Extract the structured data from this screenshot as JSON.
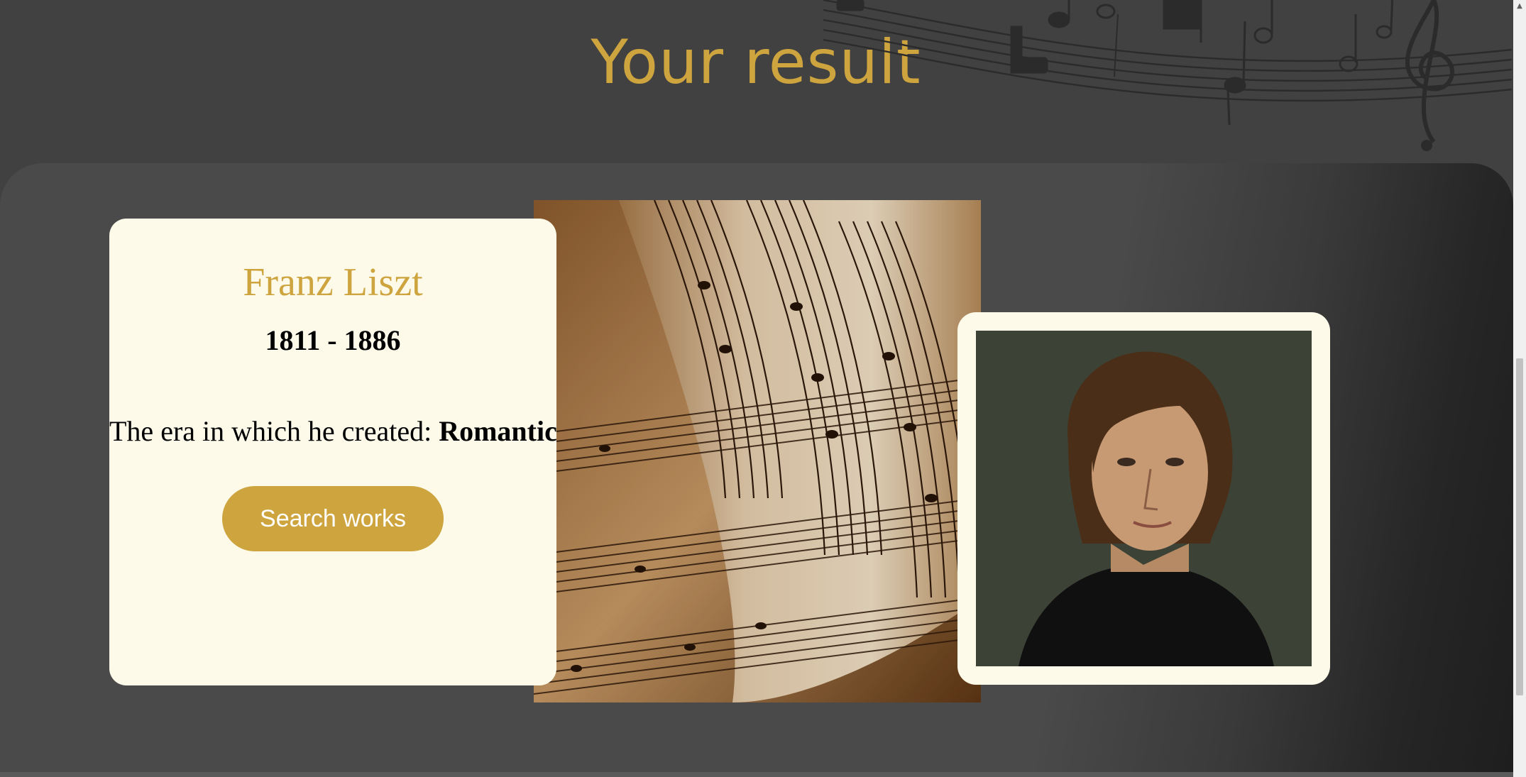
{
  "header": {
    "title": "Your result"
  },
  "result": {
    "name": "Franz Liszt",
    "years": "1811 - 1886",
    "era_label": "The era in which he created:",
    "era_value": "Romantic",
    "search_button": "Search works"
  },
  "icons": {
    "decor": "music-staff-icon",
    "scroll_up": "scroll-up-arrow-icon"
  },
  "colors": {
    "accent": "#cda43e",
    "card_background": "#fdfaea",
    "page_background": "#414141"
  }
}
